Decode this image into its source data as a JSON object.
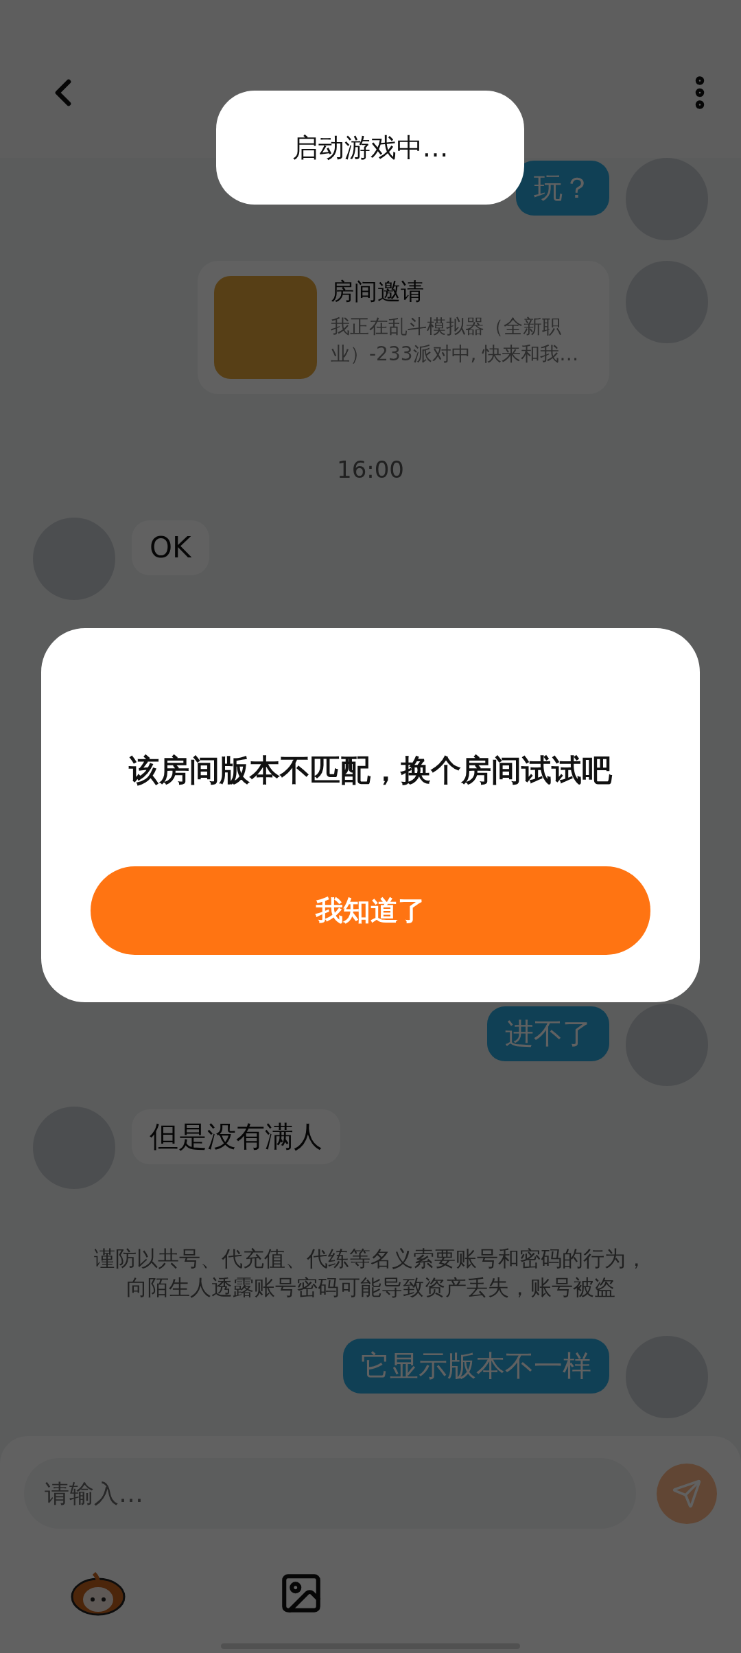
{
  "toast": {
    "text": "启动游戏中…"
  },
  "chat": {
    "earlier": [
      {
        "kind": "outgoing",
        "text": "玩？"
      },
      {
        "kind": "invite",
        "title": "房间邀请",
        "body": "我正在乱斗模拟器（全新职业）-233派对中, 快来和我…"
      },
      {
        "kind": "time",
        "text": "16:00"
      },
      {
        "kind": "incoming",
        "text": "OK"
      }
    ],
    "later": [
      {
        "kind": "outgoing",
        "text": "进不了"
      },
      {
        "kind": "incoming",
        "text": "但是没有满人"
      },
      {
        "kind": "notice",
        "text": "谨防以共号、代充值、代练等名义索要账号和密码的行为，向陌生人透露账号密码可能导致资产丢失，账号被盗"
      },
      {
        "kind": "outgoing",
        "text": "它显示版本不一样"
      }
    ]
  },
  "input": {
    "placeholder": "请输入…"
  },
  "dialog": {
    "message": "该房间版本不匹配，换个房间试试吧",
    "button": "我知道了"
  }
}
